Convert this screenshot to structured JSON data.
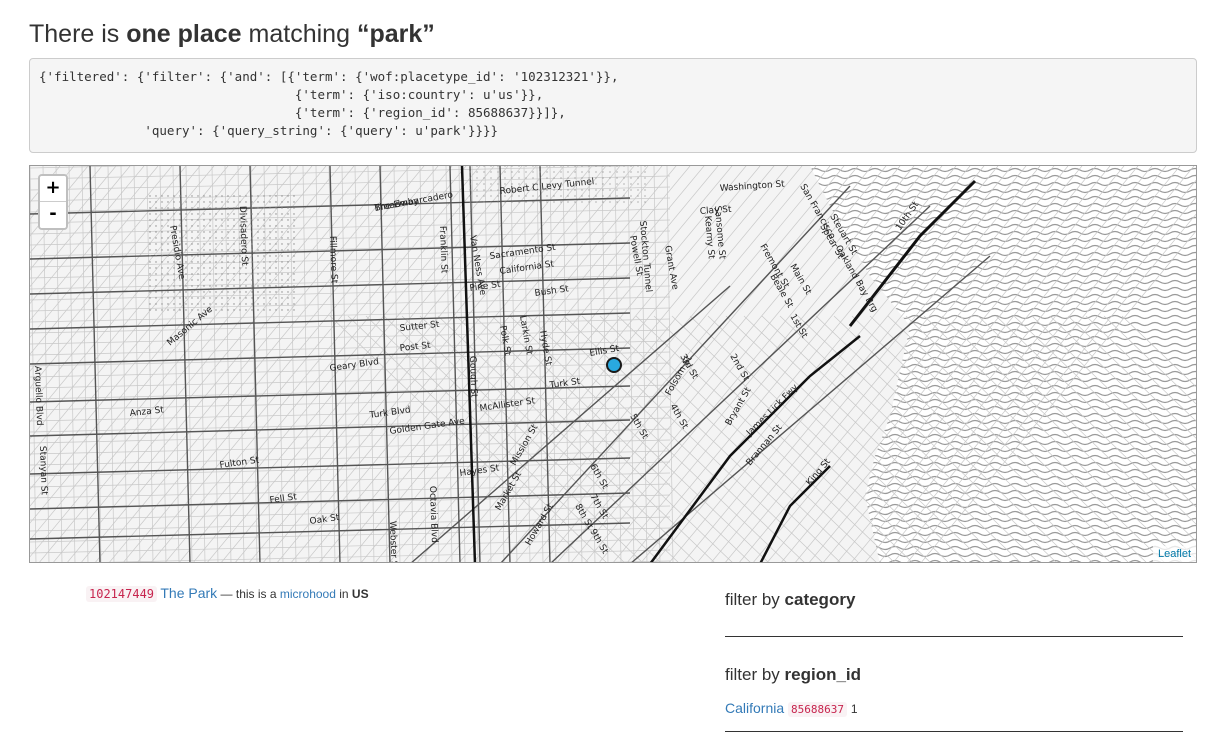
{
  "heading": {
    "prefix": "There is ",
    "count": "one place",
    "middle": " matching ",
    "query": "“park”"
  },
  "query_dsl": "{'filtered': {'filter': {'and': [{'term': {'wof:placetype_id': '102312321'}},\n                                  {'term': {'iso:country': u'us'}},\n                                  {'term': {'region_id': 85688637}}]},\n              'query': {'query_string': {'query': u'park'}}}}",
  "map": {
    "zoom_in": "+",
    "zoom_out": "-",
    "attribution": "Leaflet",
    "marker_color": "#29a9e0",
    "labels": [
      "Broadway",
      "Robert C Levy Tunnel",
      "Washington St",
      "Clay St",
      "Sacramento St",
      "California St",
      "Pine St",
      "Bush St",
      "Sutter St",
      "Post St",
      "Geary Blvd",
      "Turk St",
      "Turk Blvd",
      "Golden Gate Ave",
      "McAllister St",
      "Fulton St",
      "Hayes St",
      "Fell St",
      "Oak St",
      "Market St",
      "Mission St",
      "Howard St",
      "Folsom St",
      "Bryant St",
      "Brannan St",
      "King St",
      "James Lick Fwy",
      "Van Ness Ave",
      "Franklin St",
      "Gough St",
      "Octavia Blvd",
      "Webster St",
      "Fillmore St",
      "Divisadero St",
      "Masonic Ave",
      "Stanyan St",
      "Arguello Blvd",
      "Presidio Ave",
      "Anza St",
      "Polk St",
      "Larkin St",
      "Hyde St",
      "Ellis St",
      "Powell St",
      "Stockton Tunnel",
      "Grant Ave",
      "Kearny St",
      "Sansome St",
      "Fremont St",
      "Beale St",
      "Main St",
      "Spear St",
      "Steuart St",
      "1st St",
      "2nd St",
      "3rd St",
      "4th St",
      "5th St",
      "6th St",
      "7th St",
      "8th St",
      "9th St",
      "10th St",
      "San Francisco - Oakland Bay Brg",
      "The Embarcadero"
    ]
  },
  "result": {
    "id": "102147449",
    "name": "The Park",
    "dash": " — this is a ",
    "placetype": "microhood",
    "in": " in ",
    "country": "US"
  },
  "facets": [
    {
      "prefix": "filter by ",
      "field": "category"
    },
    {
      "prefix": "filter by ",
      "field": "region_id"
    }
  ],
  "region_facet": {
    "name": "California",
    "id": "85688637",
    "count": "1"
  }
}
